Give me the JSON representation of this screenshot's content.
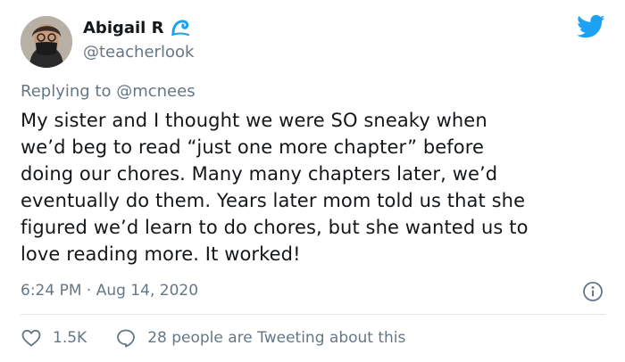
{
  "author": {
    "display_name": "Abigail R",
    "handle": "@teacherlook",
    "badge_icon": "wave-icon",
    "avatar_icon": "avatar-photo"
  },
  "brand": {
    "icon": "twitter-bird-icon",
    "color": "#1da1f2"
  },
  "reply": {
    "prefix": "Replying to",
    "mention": "@mcnees"
  },
  "tweet": {
    "text": "My sister and I thought we were SO sneaky when\nwe’d beg to read “just one more chapter” before\ndoing our chores. Many many chapters later, we’d\neventually do them. Years later mom told us that she\nfigured we’d learn to do chores, but she wanted us to\nlove reading more. It worked!",
    "timestamp": "6:24 PM · Aug 14, 2020"
  },
  "actions": {
    "likes": "1.5K",
    "reply_text": "28 people are Tweeting about this"
  },
  "colors": {
    "text": "#14171a",
    "secondary": "#657786",
    "divider": "#e1e8ed"
  }
}
